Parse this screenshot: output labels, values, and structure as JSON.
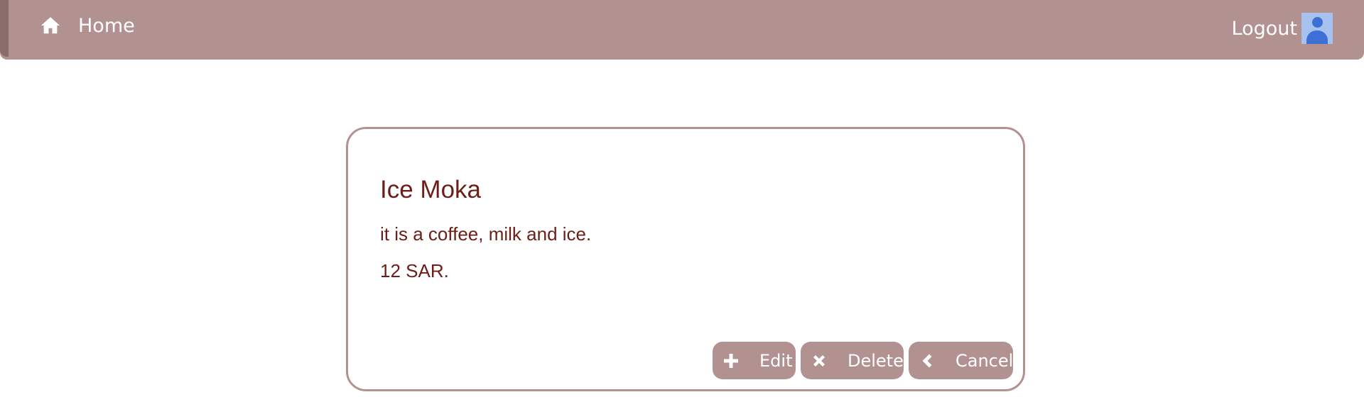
{
  "navbar": {
    "home_label": "Home",
    "home_icon": "home-icon",
    "logout_label": "Logout",
    "avatar_icon": "user-avatar-icon"
  },
  "item": {
    "name": "Ice Moka",
    "description": "it is a coffee, milk and ice.",
    "price": "12 SAR."
  },
  "actions": {
    "edit_label": "Edit",
    "edit_icon": "plus-icon",
    "delete_label": "Delete",
    "delete_icon": "close-icon",
    "cancel_label": "Cancel",
    "cancel_icon": "chevron-left-icon"
  },
  "colors": {
    "accent": "#b29290",
    "text": "#6b1f18",
    "avatar_bg": "#a8c2f0",
    "avatar_fg": "#3d6fd6"
  }
}
